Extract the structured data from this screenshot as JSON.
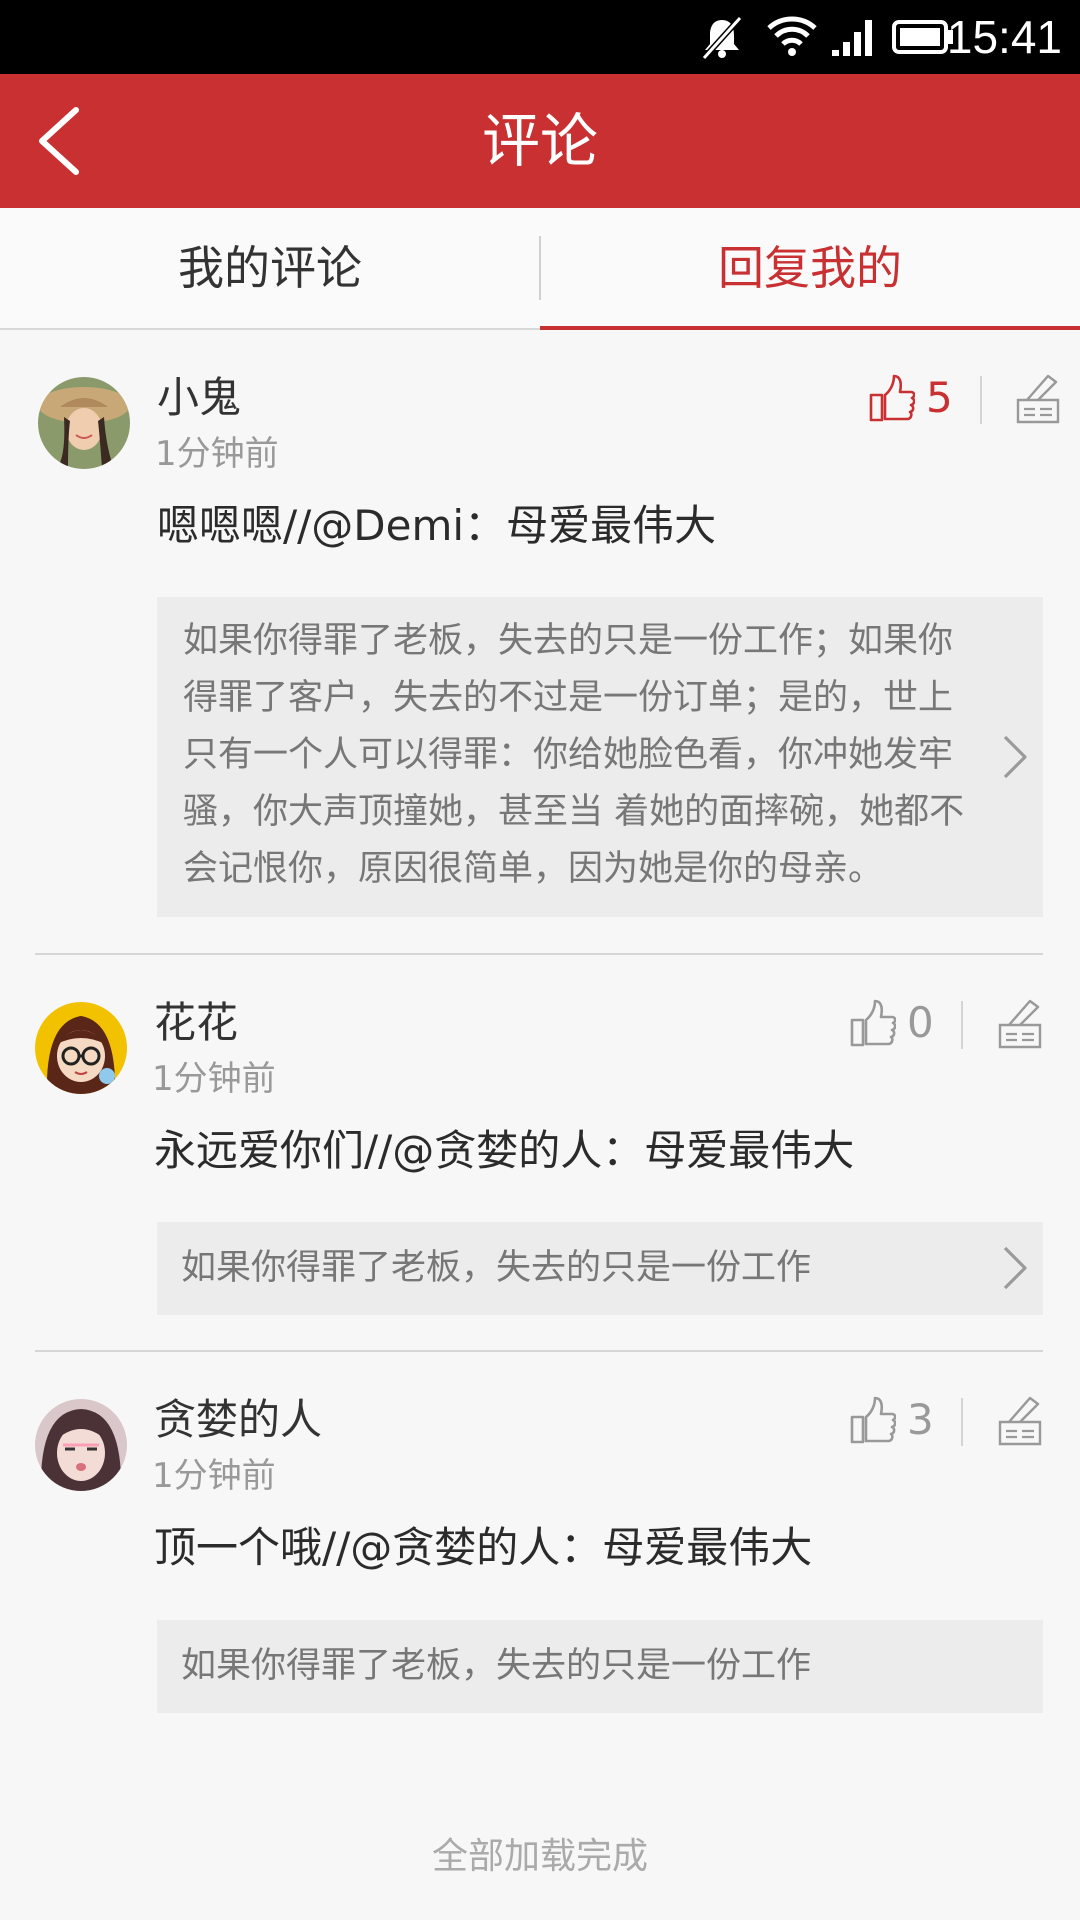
{
  "status_bar": {
    "time": "15:41",
    "icons": [
      "mute-icon",
      "wifi-icon",
      "signal-icon",
      "battery-icon"
    ]
  },
  "header": {
    "title": "评论",
    "back_icon": "chevron-left-icon"
  },
  "tabs": [
    {
      "label": "我的评论",
      "active": false
    },
    {
      "label": "回复我的",
      "active": true
    }
  ],
  "colors": {
    "accent": "#c83032",
    "status_bar": "#000000",
    "background": "#f7f7f7",
    "quote_bg": "#ececec"
  },
  "comments": [
    {
      "name": "小鬼",
      "time": "1分钟前",
      "text": "嗯嗯嗯//@Demi：母爱最伟大",
      "likes": "5",
      "liked": true,
      "quote": [
        "如果你得罪了老板，失去的只是一份工作；如果你",
        "得罪了客户，失去的不过是一份订单；是的，世上",
        "只有一个人可以得罪：你给她脸色看，你冲她发牢",
        "骚，你大声顶撞她，甚至当 着她的面摔碗，她都不",
        "会记恨你，原因很简单，因为她是你的母亲。"
      ]
    },
    {
      "name": "花花",
      "time": "1分钟前",
      "text": "永远爱你们//@贪婪的人：母爱最伟大",
      "likes": "0",
      "liked": false,
      "quote": [
        "如果你得罪了老板，失去的只是一份工作"
      ]
    },
    {
      "name": "贪婪的人",
      "time": "1分钟前",
      "text": "顶一个哦//@贪婪的人：母爱最伟大",
      "likes": "3",
      "liked": false,
      "quote": [
        "如果你得罪了老板，失去的只是一份工作"
      ]
    }
  ],
  "footer": {
    "text": "全部加载完成"
  }
}
